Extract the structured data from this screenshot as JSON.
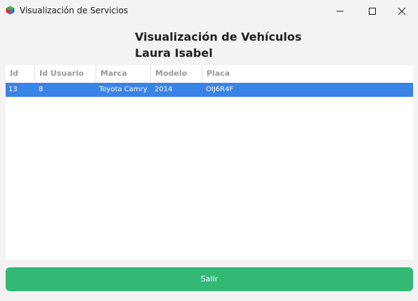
{
  "window": {
    "title": "Visualización de Servicios"
  },
  "heading": {
    "title": "Visualización de Vehículos",
    "user_name": "Laura Isabel"
  },
  "table": {
    "columns": [
      "Id",
      "Id Usuario",
      "Marca",
      "Modelo",
      "Placa"
    ],
    "rows": [
      [
        "13",
        "8",
        "Toyota Camry",
        "2014",
        "OIJ6R4F"
      ]
    ],
    "selected_row": 0
  },
  "actions": {
    "exit_label": "Salir"
  },
  "colors": {
    "selection": "#3a83e6",
    "exit_button": "#33b876"
  },
  "icons": {
    "app": "app-cube-icon",
    "minimize": "minimize-icon",
    "maximize": "maximize-icon",
    "close": "close-icon"
  }
}
